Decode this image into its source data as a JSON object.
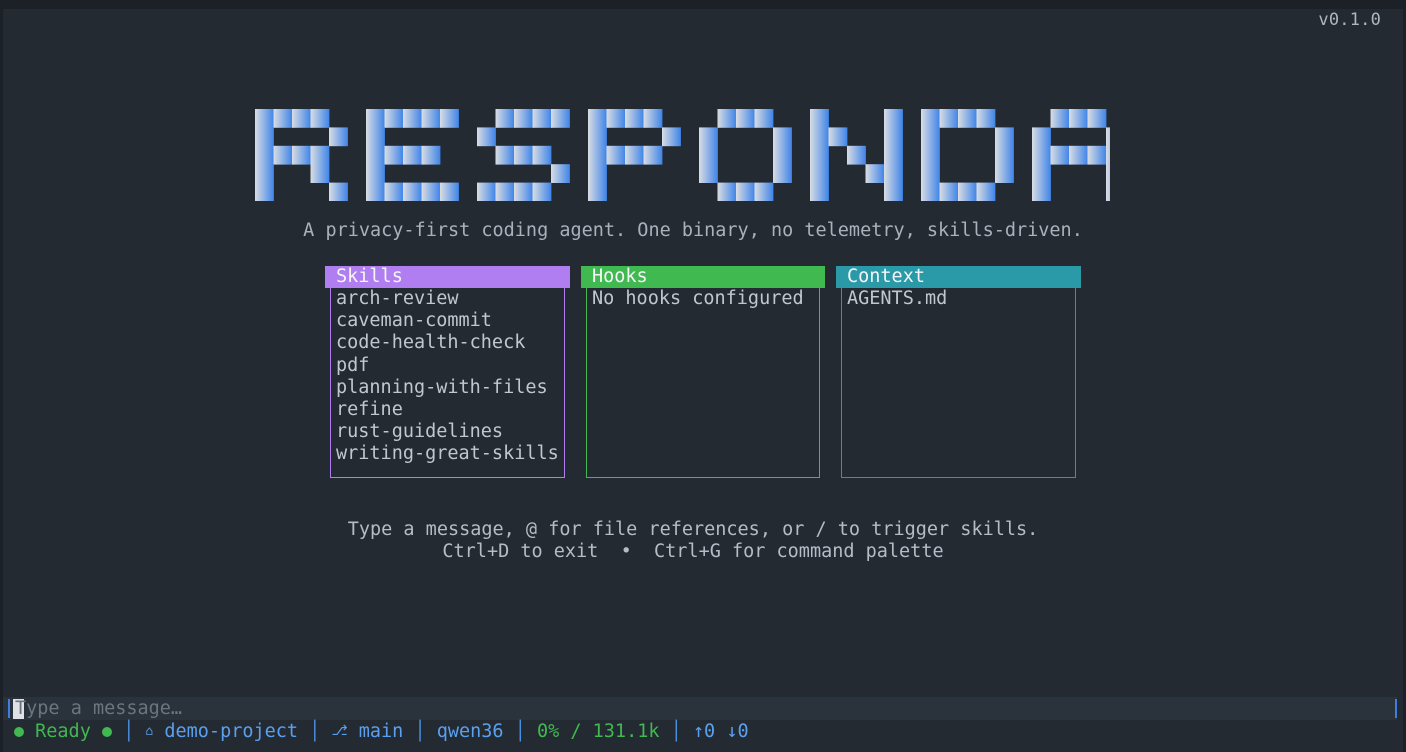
{
  "version": "v0.1.0",
  "logo_text": "RESPONDAMI",
  "tagline": "A privacy-first coding agent. One binary, no telemetry, skills-driven.",
  "panels": {
    "skills": {
      "title": "Skills",
      "color": "#b07ef0",
      "items": [
        "arch-review",
        "caveman-commit",
        "code-health-check",
        "pdf",
        "planning-with-files",
        "refine",
        "rust-guidelines",
        "writing-great-skills"
      ]
    },
    "hooks": {
      "title": "Hooks",
      "color": "#3fb950",
      "items": [
        "No hooks configured"
      ]
    },
    "context": {
      "title": "Context",
      "color": "#2a9aa8",
      "items": [
        "AGENTS.md"
      ]
    }
  },
  "help": {
    "line1": "Type a message, @ for file references, or / to trigger skills.",
    "line2": "Ctrl+D to exit  •  Ctrl+G for command palette"
  },
  "input": {
    "placeholder": "Type a message…",
    "value": ""
  },
  "status_bar": {
    "state": "Ready",
    "project_icon": "folder-icon",
    "project": "demo-project",
    "branch_icon": "git-branch-icon",
    "branch": "main",
    "model": "qwen36",
    "context_usage": "0% / 131.1k",
    "tokens": "↑0 ↓0"
  },
  "colors": {
    "background": "#232a32",
    "logo_gradient_start": "#d9dde3",
    "logo_gradient_end": "#3f84e8",
    "ready": "#3fb950",
    "accent_blue": "#5aa0f0"
  }
}
